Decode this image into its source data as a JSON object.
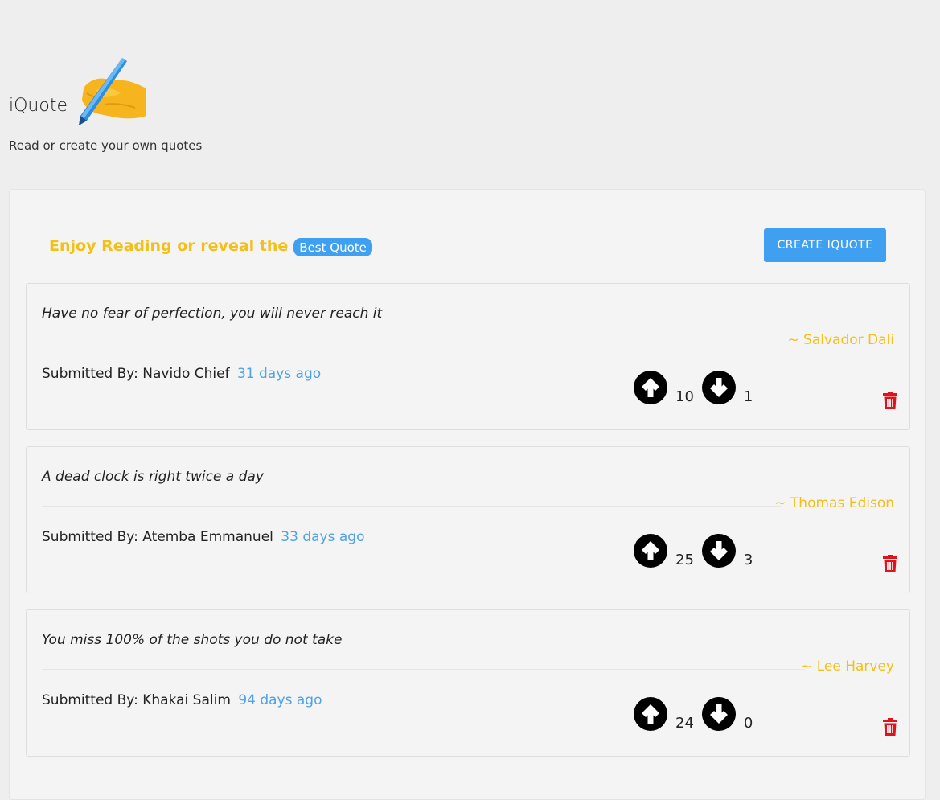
{
  "app": {
    "title": "iQuote",
    "tagline": "Read or create your own quotes",
    "logo_icon": "writing-hand-icon"
  },
  "panel": {
    "heading": "Enjoy Reading or reveal the",
    "badge": "Best Quote",
    "create_button": "CREATE IQUOTE"
  },
  "colors": {
    "accent_yellow": "#f5c016",
    "accent_blue": "#3f9ff0",
    "delete_red": "#e0121c",
    "time_blue": "#4da3e6"
  },
  "quotes": [
    {
      "text": "Have no fear of perfection, you will never reach it",
      "author": "~ Salvador Dali",
      "submitted_label": "Submitted By:",
      "submitter": "Navido Chief",
      "time": "31 days ago",
      "upvotes": "10",
      "downvotes": "1"
    },
    {
      "text": "A dead clock is right twice a day",
      "author": "~ Thomas Edison",
      "submitted_label": "Submitted By:",
      "submitter": "Atemba Emmanuel",
      "time": "33 days ago",
      "upvotes": "25",
      "downvotes": "3"
    },
    {
      "text": "You miss 100% of the shots you do not take",
      "author": "~ Lee Harvey",
      "submitted_label": "Submitted By:",
      "submitter": "Khakai Salim",
      "time": "94 days ago",
      "upvotes": "24",
      "downvotes": "0"
    }
  ]
}
